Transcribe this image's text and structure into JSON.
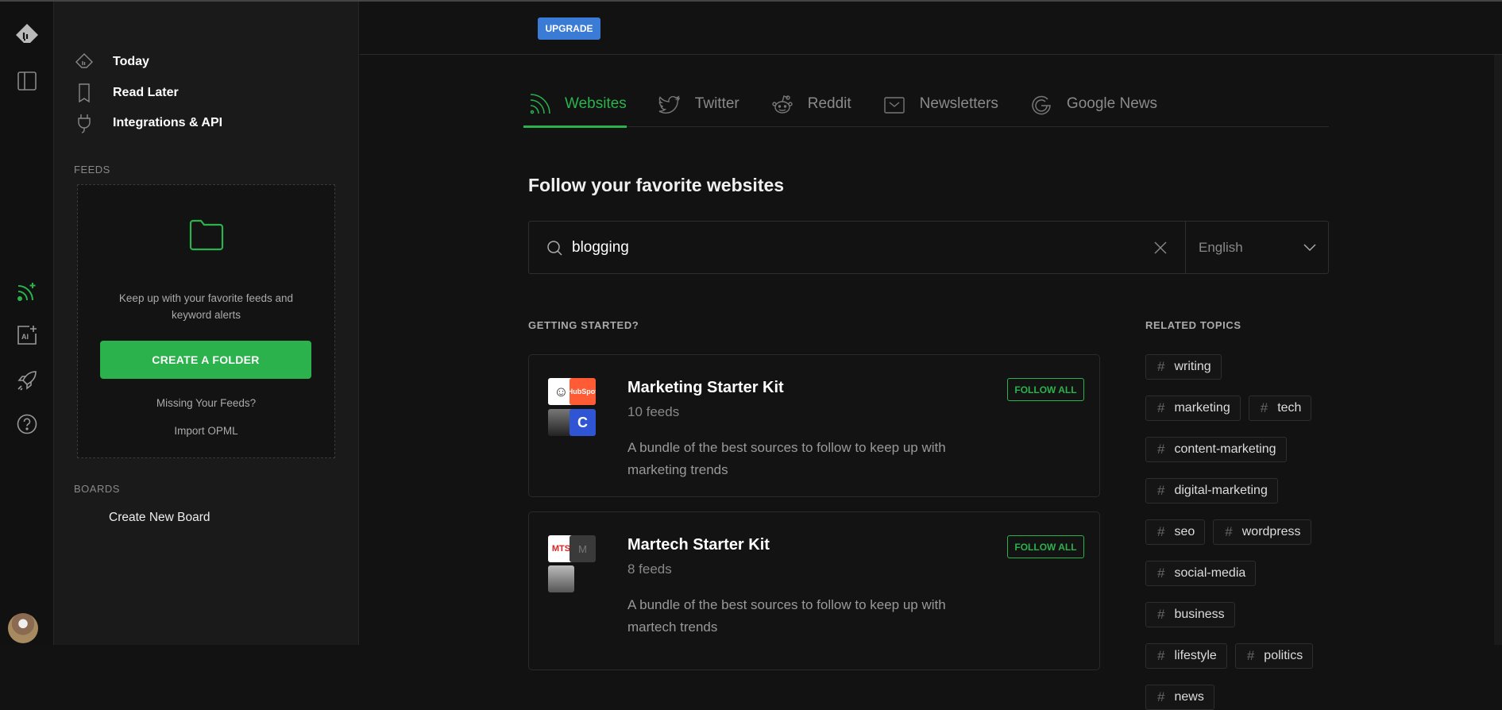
{
  "colors": {
    "accent": "#2bb24c",
    "upgrade": "#3a7bd5"
  },
  "rail": {
    "icons": [
      "feedly-logo-icon",
      "layout-sidebar-icon",
      "rss-add-icon",
      "ai-add-icon",
      "rocket-icon",
      "help-icon",
      "avatar"
    ]
  },
  "sidebar": {
    "nav": [
      {
        "label": "Today",
        "icon": "today-icon"
      },
      {
        "label": "Read Later",
        "icon": "bookmark-icon"
      },
      {
        "label": "Integrations & API",
        "icon": "plug-icon"
      }
    ],
    "feeds_label": "FEEDS",
    "feeds_empty": {
      "text": "Keep up with your favorite feeds and keyword alerts",
      "create_button": "CREATE A FOLDER",
      "missing_link": "Missing Your Feeds?",
      "import_link": "Import OPML"
    },
    "boards_label": "BOARDS",
    "create_board": "Create New Board"
  },
  "header": {
    "upgrade": "UPGRADE"
  },
  "tabs": [
    {
      "label": "Websites",
      "icon": "rss-icon",
      "active": true
    },
    {
      "label": "Twitter",
      "icon": "twitter-icon"
    },
    {
      "label": "Reddit",
      "icon": "reddit-icon"
    },
    {
      "label": "Newsletters",
      "icon": "mail-icon"
    },
    {
      "label": "Google News",
      "icon": "google-icon"
    }
  ],
  "main": {
    "title": "Follow your favorite websites",
    "search": {
      "value": "blogging",
      "language": "English"
    },
    "getting_started": "GETTING STARTED?",
    "related_topics_label": "RELATED TOPICS",
    "kits": [
      {
        "title": "Marketing Starter Kit",
        "feeds": "10 feeds",
        "description": "A bundle of the best sources to follow to keep up with marketing trends",
        "follow": "FOLLOW ALL",
        "logos": [
          "person",
          "HubSpot",
          "person",
          "C"
        ]
      },
      {
        "title": "Martech Starter Kit",
        "feeds": "8 feeds",
        "description": "A bundle of the best sources to follow to keep up with martech trends",
        "follow": "FOLLOW ALL",
        "logos": [
          "MTS",
          "M",
          "person"
        ]
      }
    ],
    "topics": [
      "writing",
      "marketing",
      "tech",
      "content-marketing",
      "digital-marketing",
      "seo",
      "wordpress",
      "social-media",
      "business",
      "lifestyle",
      "politics",
      "news"
    ]
  }
}
